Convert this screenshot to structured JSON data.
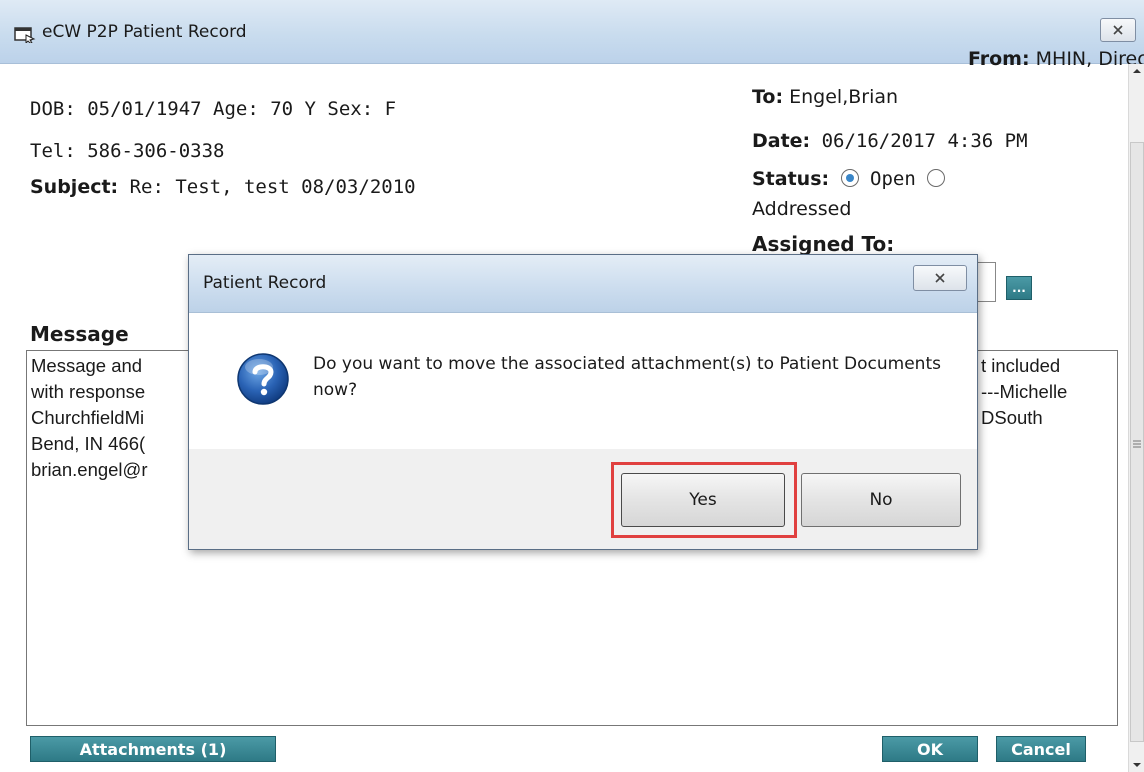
{
  "window": {
    "title": "eCW P2P Patient Record"
  },
  "patient": {
    "dob_line": "DOB: 05/01/1947 Age: 70 Y Sex: F",
    "tel_line": "Tel: 586-306-0338",
    "subject_label": "Subject:",
    "subject_value": " Re: Test, test 08/03/2010"
  },
  "header_right": {
    "from_label": "From:",
    "from_value": " MHIN, Direct",
    "to_label": "To:",
    "to_value": " Engel,Brian",
    "date_label": "Date:",
    "date_value": " 06/16/2017 4:36 PM",
    "status_label": "Status:",
    "status_open": "Open",
    "status_addressed": "Addressed",
    "assigned_label": "Assigned To:",
    "lookup_label": "..."
  },
  "message": {
    "label": "Message",
    "lines_left": [
      "Message and",
      "with response",
      "ChurchfieldMi",
      "Bend, IN 466(",
      "brian.engel@r"
    ],
    "lines_right": [
      "t included",
      "---Michelle",
      "DSouth"
    ]
  },
  "buttons": {
    "attachments": "Attachments (1)",
    "ok": "OK",
    "cancel": "Cancel"
  },
  "dialog": {
    "title": "Patient Record",
    "message": "Do you want to move the associated attachment(s) to Patient Documents now?",
    "yes": "Yes",
    "no": "No"
  },
  "colors": {
    "accent_teal": "#2e7a86",
    "highlight_red": "#e0403f",
    "radio_selected": "#3a86c8"
  }
}
